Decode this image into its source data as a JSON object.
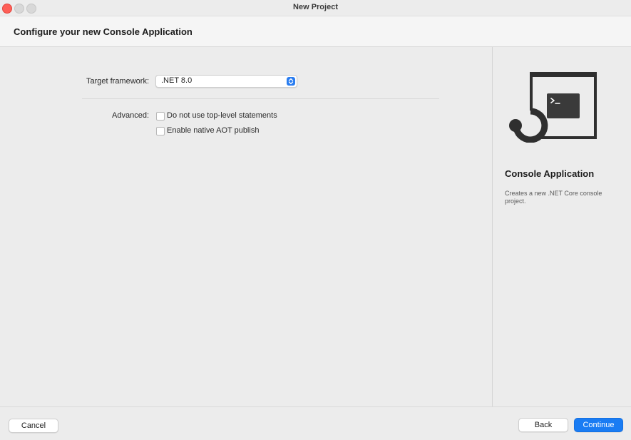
{
  "window": {
    "title": "New Project"
  },
  "header": {
    "title": "Configure your new Console Application"
  },
  "form": {
    "target_framework": {
      "label": "Target framework:",
      "value": ".NET 8.0"
    },
    "advanced": {
      "label": "Advanced:",
      "options": [
        {
          "label": "Do not use top-level statements",
          "checked": false
        },
        {
          "label": "Enable native AOT publish",
          "checked": false
        }
      ]
    }
  },
  "side_panel": {
    "icon": "console-application-icon",
    "title": "Console Application",
    "description": "Creates a new .NET Core console project."
  },
  "footer": {
    "cancel_label": "Cancel",
    "back_label": "Back",
    "continue_label": "Continue"
  },
  "colors": {
    "accent": "#1a7cf3",
    "close": "#fe5f57"
  }
}
